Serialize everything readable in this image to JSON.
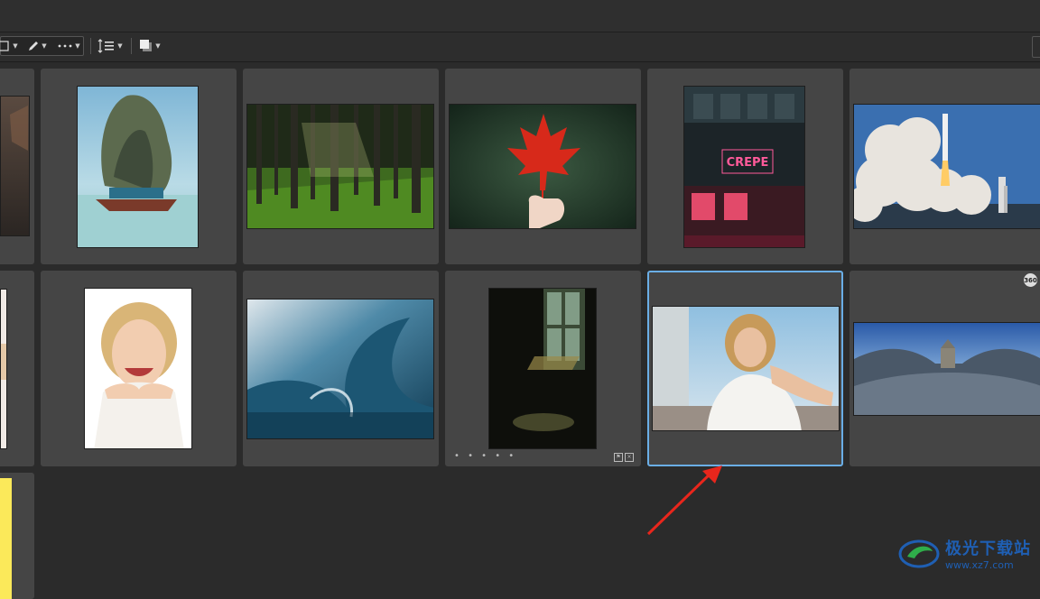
{
  "colors": {
    "background": "#2b2b2b",
    "cell": "#454545",
    "selection": "#6aaee6",
    "annotation_arrow": "#e8261c",
    "watermark": "#1f5fb3"
  },
  "toolbar": {
    "items": [
      {
        "name": "view-mode-icon"
      },
      {
        "name": "edit-pen-icon"
      },
      {
        "name": "more-options-icon"
      },
      {
        "name": "sort-order-icon"
      },
      {
        "name": "stack-icon"
      }
    ]
  },
  "thumbnails": [
    {
      "name": "thumb-partial-left-row1",
      "subject": "partial photo"
    },
    {
      "name": "thumb-rock-boat",
      "subject": "limestone rock with boat"
    },
    {
      "name": "thumb-forest",
      "subject": "sunlit forest"
    },
    {
      "name": "thumb-maple-leaf",
      "subject": "red maple leaf in hand"
    },
    {
      "name": "thumb-neon-cafe",
      "subject": "Crepe cafe neon sign"
    },
    {
      "name": "thumb-rocket-launch",
      "subject": "rocket launch"
    },
    {
      "name": "thumb-partial-left-row2",
      "subject": "partial photo"
    },
    {
      "name": "thumb-smiling-woman",
      "subject": "smiling blonde woman"
    },
    {
      "name": "thumb-ocean-wave",
      "subject": "ocean wave"
    },
    {
      "name": "thumb-dark-window",
      "subject": "window light in dark room"
    },
    {
      "name": "thumb-woman-outdoors",
      "subject": "woman smiling outdoors",
      "selected": true
    },
    {
      "name": "thumb-panorama",
      "subject": "360 panorama"
    },
    {
      "name": "thumb-yellow-partial",
      "subject": "yellow"
    }
  ],
  "cafe_sign": "CREPE",
  "badge_360": "360",
  "rating_dots": "• • • • •",
  "watermark": {
    "title": "极光下载站",
    "url": "www.xz7.com"
  }
}
